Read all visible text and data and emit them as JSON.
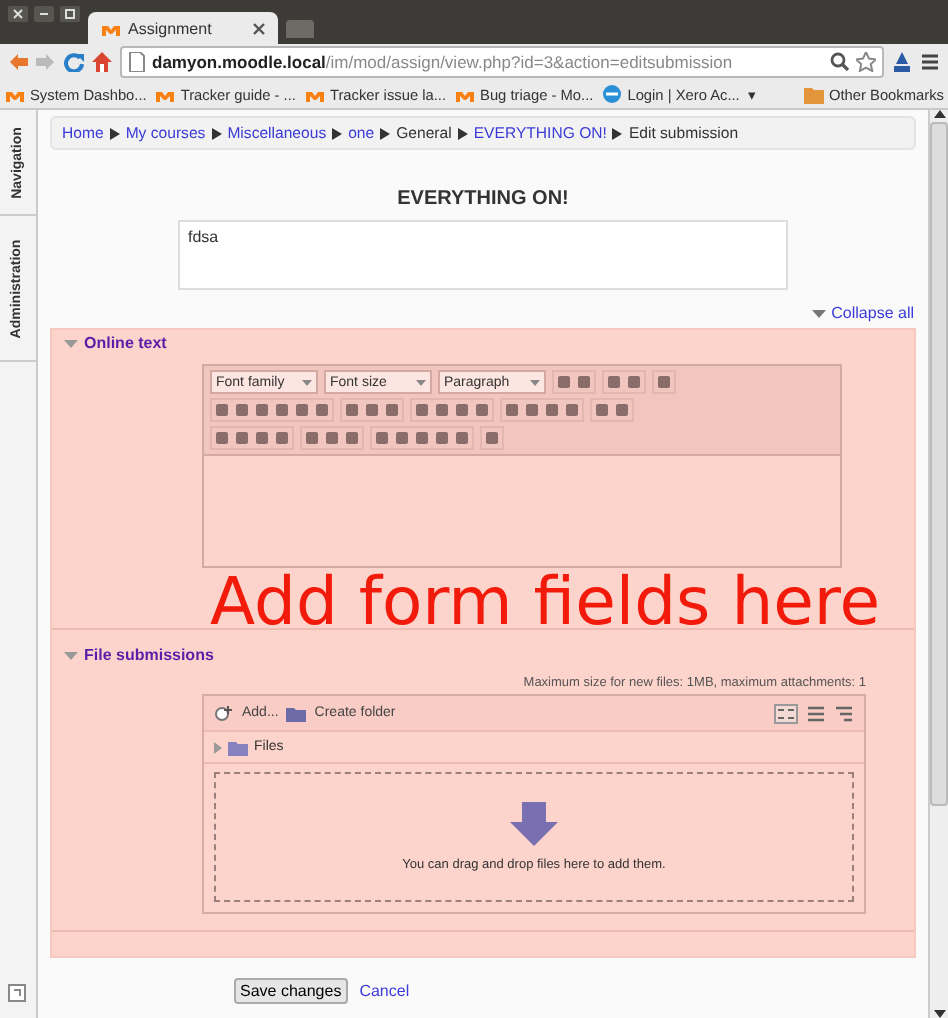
{
  "browser": {
    "tab_title": "Assignment",
    "url_host": "damyon.moodle.local",
    "url_path": "/im/mod/assign/view.php?id=3&action=editsubmission",
    "bookmarks": [
      {
        "label": "System Dashbo...",
        "kind": "moodle"
      },
      {
        "label": "Tracker guide - ...",
        "kind": "moodle"
      },
      {
        "label": "Tracker issue la...",
        "kind": "moodle"
      },
      {
        "label": "Bug triage - Mo...",
        "kind": "moodle"
      },
      {
        "label": "Login | Xero Ac...",
        "kind": "globe"
      }
    ],
    "more": "▾",
    "other_bookmarks": "Other Bookmarks"
  },
  "sidebar": {
    "tabs": [
      {
        "label": "Navigation"
      },
      {
        "label": "Administration"
      }
    ]
  },
  "breadcrumb": [
    {
      "label": "Home",
      "link": true
    },
    {
      "label": "My courses",
      "link": true
    },
    {
      "label": "Miscellaneous",
      "link": true
    },
    {
      "label": "one",
      "link": true
    },
    {
      "label": "General",
      "link": false
    },
    {
      "label": "EVERYTHING ON!",
      "link": true
    },
    {
      "label": "Edit submission",
      "link": false
    }
  ],
  "page_title": "EVERYTHING ON!",
  "intro_text": "fdsa",
  "collapse_all": "Collapse all",
  "sections": [
    {
      "title": "Online text",
      "expanded": true,
      "kind": "editor"
    },
    {
      "title": "File submissions",
      "expanded": true,
      "kind": "files"
    }
  ],
  "editor": {
    "font_family": "Font family",
    "font_size": "Font size",
    "format": "Paragraph"
  },
  "files": {
    "limits": "Maximum size for new files: 1MB, maximum attachments: 1",
    "add": "Add...",
    "create_folder": "Create folder",
    "folder": "Files",
    "drop_text": "You can drag and drop files here to add them."
  },
  "overlay_text": "Add form fields here",
  "buttons": {
    "save": "Save changes",
    "cancel": "Cancel"
  }
}
